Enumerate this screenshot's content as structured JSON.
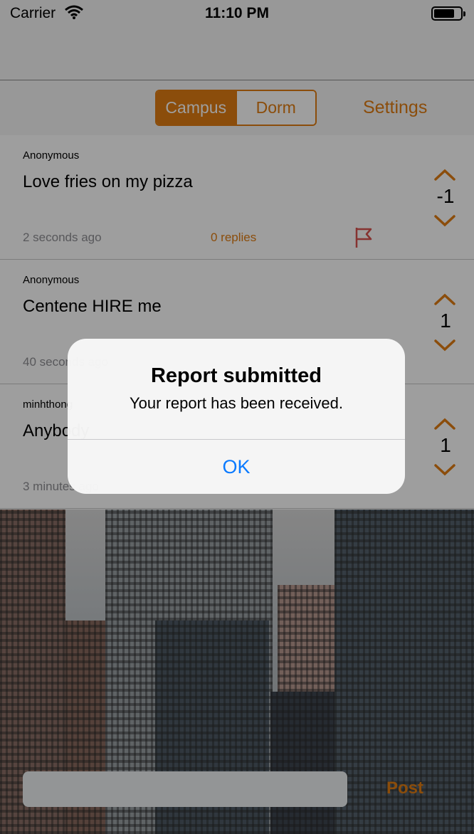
{
  "status_bar": {
    "carrier": "Carrier",
    "time": "11:10 PM"
  },
  "nav": {
    "segments": [
      {
        "label": "Campus",
        "selected": true
      },
      {
        "label": "Dorm",
        "selected": false
      }
    ],
    "settings_label": "Settings"
  },
  "posts": [
    {
      "author": "Anonymous",
      "text": "Love fries on my pizza",
      "time": "2 seconds ago",
      "replies": "0 replies",
      "votes": "-1"
    },
    {
      "author": "Anonymous",
      "text": "Centene HIRE me",
      "time": "40 seconds ago",
      "replies": "",
      "votes": "1"
    },
    {
      "author": "minhthong",
      "text": "Anybody",
      "time": "3 minutes ago",
      "replies": "",
      "votes": "1"
    }
  ],
  "composer": {
    "placeholder": "",
    "post_label": "Post"
  },
  "alert": {
    "title": "Report submitted",
    "message": "Your report has been received.",
    "ok_label": "OK"
  },
  "colors": {
    "accent": "#e07c12",
    "link": "#0a7aff",
    "flag": "#d9534f"
  },
  "icons": {
    "wifi": "wifi-icon",
    "battery": "battery-icon",
    "flag": "flag-icon",
    "up": "chevron-up-icon",
    "down": "chevron-down-icon"
  }
}
